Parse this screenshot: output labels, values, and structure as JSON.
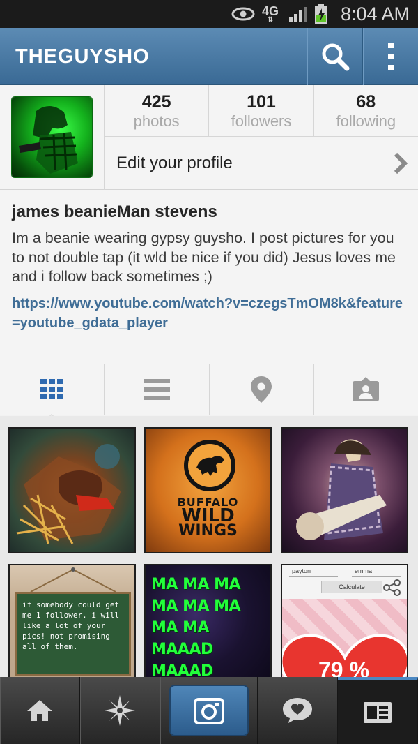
{
  "status_bar": {
    "network": "4G",
    "time": "8:04 AM"
  },
  "action_bar": {
    "title": "THEGUYSHO"
  },
  "profile": {
    "stats": [
      {
        "value": "425",
        "label": "photos"
      },
      {
        "value": "101",
        "label": "followers"
      },
      {
        "value": "68",
        "label": "following"
      }
    ],
    "edit_label": "Edit your profile"
  },
  "bio": {
    "name": "james beanieMan stevens",
    "text": "Im a beanie wearing gypsy guysho. I post pictures for you to not double tap (it wld be nice if you did) Jesus loves me and i follow back sometimes ;)",
    "link": "https://www.youtube.com/watch?v=czegsTmOM8k&feature=youtube_gdata_player"
  },
  "tabs": [
    "grid-view-icon",
    "list-view-icon",
    "map-pin-icon",
    "tagged-photos-icon"
  ],
  "photos": {
    "bww_line1": "BUFFALO",
    "bww_line2": "WILD",
    "bww_line3": "WINGS",
    "chalk_text": "if somebody could get me 1 follower. i will like a lot of your pics! not promising all of them.",
    "ma_text": "MA MA MA MA MA MA MA MA MAAAD MAAAD MAAAD!",
    "calc_name1": "payton",
    "calc_name2": "emma",
    "calc_button": "Calculate",
    "calc_percent": "79 %"
  },
  "bottom_nav": [
    "home-icon",
    "explore-icon",
    "camera-icon",
    "news-icon",
    "profile-icon"
  ],
  "colors": {
    "action_bar": "#4a7aa5",
    "link": "#3f6d96",
    "active_tab": "#2f6ab0"
  }
}
